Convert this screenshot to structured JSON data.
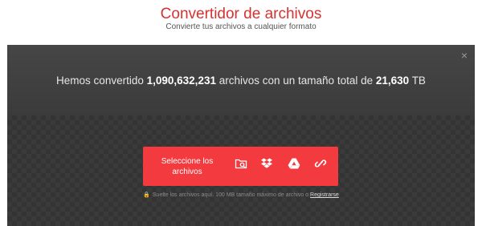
{
  "header": {
    "title": "Convertidor de archivos",
    "subtitle": "Convierte tus archivos a cualquier formato"
  },
  "stats": {
    "prefix": "Hemos convertido",
    "files_count": "1,090,632,231",
    "middle": "archivos con un tamaño total de",
    "total_size": "21,630",
    "unit": "TB"
  },
  "upload": {
    "select_label": "Seleccione los archivos",
    "sources": [
      "folder-search-icon",
      "dropbox-icon",
      "google-drive-icon",
      "link-icon"
    ]
  },
  "note": {
    "text": "Suelte los archivos aquí. 100 MB tamaño máximo de archivo o",
    "link_label": "Registrarse"
  },
  "panel": {
    "close_icon": "×"
  },
  "colors": {
    "accent": "#f23a3f",
    "title": "#d9312f",
    "panel": "#3c3c3c"
  }
}
